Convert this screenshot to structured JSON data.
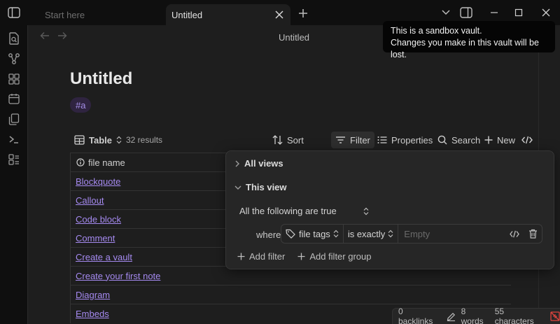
{
  "window": {
    "tabs": [
      {
        "label": "Start here",
        "active": false
      },
      {
        "label": "Untitled",
        "active": true
      }
    ]
  },
  "view": {
    "header_title": "Untitled",
    "note_title": "Untitled",
    "tag": "#a"
  },
  "base": {
    "view_name": "Table",
    "results": "32 results",
    "toolbar": {
      "sort": "Sort",
      "filter": "Filter",
      "properties": "Properties",
      "search": "Search",
      "new": "New"
    },
    "table": {
      "column_header": "file name",
      "rows": [
        "Blockquote",
        "Callout",
        "Code block",
        "Comment",
        "Create a vault",
        "Create your first note",
        "Diagram",
        "Embeds"
      ]
    }
  },
  "filter_popover": {
    "all_views": "All views",
    "this_view": "This view",
    "conjunction": "All the following are true",
    "where_label": "where",
    "property": "file tags",
    "operator": "is exactly",
    "value_placeholder": "Empty",
    "add_filter": "Add filter",
    "add_filter_group": "Add filter group"
  },
  "notice": {
    "line1": "This is a sandbox vault.",
    "line2": "Changes you make in this vault will be lost."
  },
  "statusbar": {
    "backlinks": "0 backlinks",
    "words": "8 words",
    "characters": "55 characters"
  },
  "colors": {
    "link": "#a58af0",
    "tag_bg": "#2f2440",
    "sync_error": "#e0443e"
  }
}
